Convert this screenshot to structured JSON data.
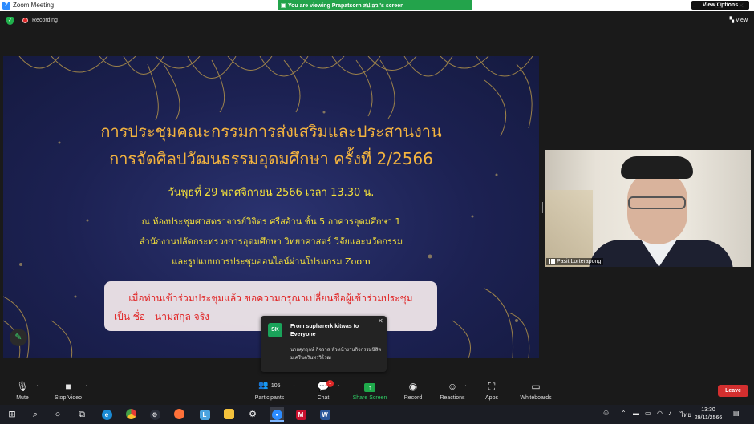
{
  "window": {
    "title": "Zoom Meeting",
    "minimize": "–",
    "maximize": "❐",
    "close": "✕"
  },
  "share_banner": {
    "text": "You are viewing Prapatsorn สป.อว.'s screen",
    "view_options": "View Options"
  },
  "status": {
    "recording": "Recording",
    "view": "View"
  },
  "slide": {
    "title_line1": "การประชุมคณะกรรมการส่งเสริมและประสานงาน",
    "title_line2": "การจัดศิลปวัฒนธรรมอุดมศึกษา ครั้งที่ 2/2566",
    "date_line": "วันพุธที่ 29 พฤศจิกายน 2566   เวลา 13.30 น.",
    "place_line1": "ณ  ห้องประชุมศาสตราจารย์วิจิตร ศรีสอ้าน ชั้น 5  อาคารอุดมศึกษา 1",
    "place_line2": "สำนักงานปลัดกระทรวงการอุดมศึกษา วิทยาศาสตร์ วิจัยและนวัตกรรม",
    "place_line3": "และรูปแบบการประชุมออนไลน์ผ่านโปรแกรม Zoom",
    "notice_line1": "เมื่อท่านเข้าร่วมประชุมแล้ว ขอความกรุณาเปลี่ยนชื่อผู้เข้าร่วมประชุม",
    "notice_line2": "เป็น ชื่อ - นามสกุล จริง"
  },
  "video": {
    "participant_name": "Pasit Lorterapong"
  },
  "chat_popup": {
    "avatar_initials": "SK",
    "from": "From supharerk kitwas to Everyone",
    "message": "นายศุภฤกษ์ กิจวาส หัวหน้างานกิจกรรมนิสิต ม.ศรีนครินทรวิโรฒ"
  },
  "toolbar": {
    "mute": "Mute",
    "stop_video": "Stop Video",
    "participants_count": "105",
    "participants": "Participants",
    "chat": "Chat",
    "chat_badge": "1",
    "share_screen": "Share Screen",
    "record": "Record",
    "reactions": "Reactions",
    "apps": "Apps",
    "whiteboards": "Whiteboards",
    "leave": "Leave"
  },
  "taskbar": {
    "language": "ไทย",
    "time": "13:30",
    "date": "29/11/2566"
  },
  "colors": {
    "zoom_blue": "#2D8CFF",
    "share_green": "#23a34b",
    "leave_red": "#d32f2f",
    "slide_title_gold": "#f3b33f",
    "slide_text_yellow": "#f6e23a",
    "notice_red": "#e12222"
  }
}
